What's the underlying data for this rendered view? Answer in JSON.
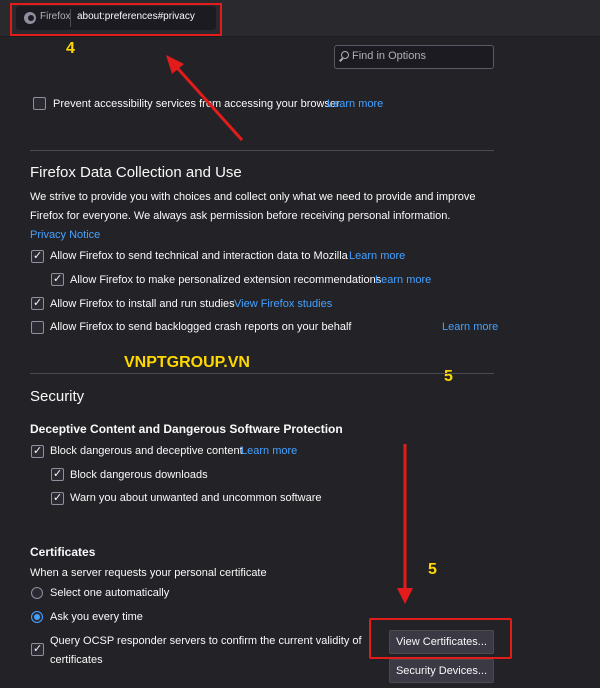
{
  "urlbar": {
    "browser_label": "Firefox",
    "url": "about:preferences#privacy"
  },
  "search": {
    "placeholder": "Find in Options"
  },
  "accessibility": {
    "label": "Prevent accessibility services from accessing your browser",
    "link": "Learn more",
    "checked": false
  },
  "data_collection": {
    "title": "Firefox Data Collection and Use",
    "desc_line1": "We strive to provide you with choices and collect only what we need to provide and improve",
    "desc_line2": "Firefox for everyone. We always ask permission before receiving personal information.",
    "privacy_notice": "Privacy Notice",
    "items": [
      {
        "label": "Allow Firefox to send technical and interaction data to Mozilla",
        "link": "Learn more",
        "checked": true
      },
      {
        "label": "Allow Firefox to make personalized extension recommendations",
        "link": "Learn more",
        "checked": true
      },
      {
        "label": "Allow Firefox to install and run studies",
        "link": "View Firefox studies",
        "checked": true
      },
      {
        "label": "Allow Firefox to send backlogged crash reports on your behalf",
        "link": "Learn more",
        "checked": false
      }
    ]
  },
  "security": {
    "title": "Security",
    "deceptive_title": "Deceptive Content and Dangerous Software Protection",
    "items": [
      {
        "label": "Block dangerous and deceptive content",
        "link": "Learn more",
        "checked": true
      },
      {
        "label": "Block dangerous downloads",
        "checked": true
      },
      {
        "label": "Warn you about unwanted and uncommon software",
        "checked": true
      }
    ]
  },
  "certificates": {
    "title": "Certificates",
    "prompt": "When a server requests your personal certificate",
    "options": [
      {
        "label": "Select one automatically",
        "selected": false
      },
      {
        "label": "Ask you every time",
        "selected": true
      }
    ],
    "ocsp_line1": "Query OCSP responder servers to confirm the current validity of",
    "ocsp_line2": "certificates",
    "ocsp_checked": true,
    "view_button": "View Certificates...",
    "devices_button": "Security Devices..."
  },
  "annotations": {
    "watermark": "VNPTGROUP.VN",
    "step4": "4",
    "step5_top": "5",
    "step5_bottom": "5"
  },
  "colors": {
    "accent": "#45a1ff",
    "annotation_red": "#e21b1b",
    "annotation_yellow": "#ffd800"
  }
}
